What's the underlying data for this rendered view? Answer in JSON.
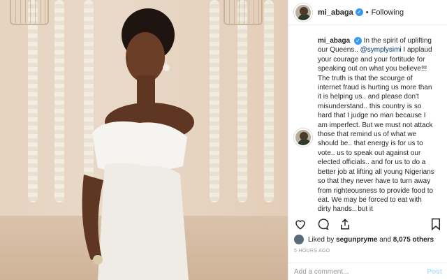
{
  "post": {
    "username": "mi_abaga",
    "following_label": "Following",
    "separator": "•",
    "caption_username": "mi_abaga",
    "caption_before": " In the spirit of uplifting our Queens.. ",
    "mention": "@symplysimi",
    "caption_after": " I applaud your courage and your fortitude for speaking out on what you believe!!! The truth is that the scourge of internet fraud is hurting us more than it is helping us.. and please don't misunderstand.. this country is so hard that I judge no man because I am imperfect. But we must not attack those that remind us of what we should be.. that energy is for us to vote.. us to speak out against our elected officials.. and for us to do a better job at lifting all young Nigerians so that they never have to turn away from righteousness to provide food to eat. We may be forced to eat with dirty hands.. but it",
    "likes_prefix": "Liked by ",
    "liked_by": "segunpryme",
    "likes_and": " and ",
    "likes_count": "8,075 others",
    "time": "5 HOURS AGO",
    "comment_placeholder": "Add a comment...",
    "post_button": "Post"
  },
  "colors": {
    "link": "#003569",
    "verified": "#3897f0",
    "post_disabled": "#b2dffc"
  },
  "icons": [
    "heart-icon",
    "comment-icon",
    "share-icon",
    "bookmark-icon",
    "verified-icon"
  ]
}
